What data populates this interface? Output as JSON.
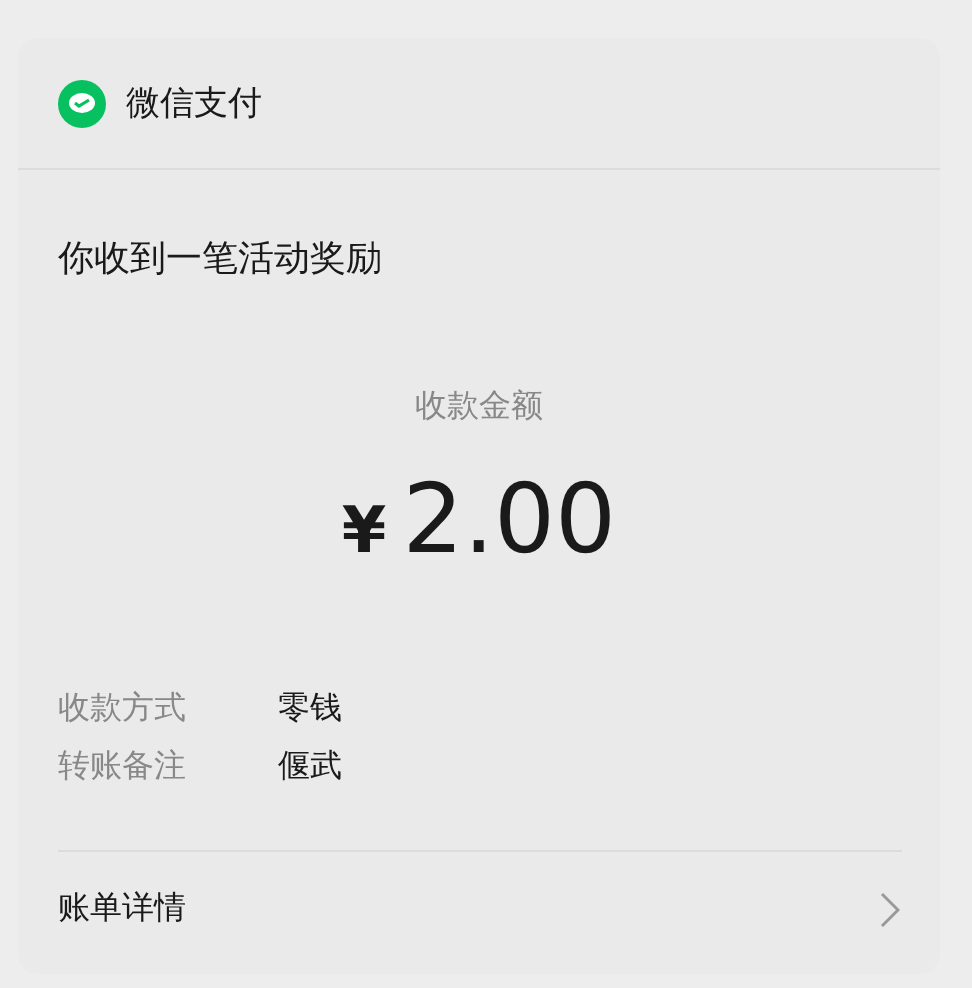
{
  "header": {
    "title": "微信支付"
  },
  "message": "你收到一笔活动奖励",
  "amount": {
    "label": "收款金额",
    "currency": "¥",
    "value": "2.00"
  },
  "details": [
    {
      "label": "收款方式",
      "value": "零钱"
    },
    {
      "label": "转账备注",
      "value": "偃武"
    }
  ],
  "footer_link": "账单详情"
}
